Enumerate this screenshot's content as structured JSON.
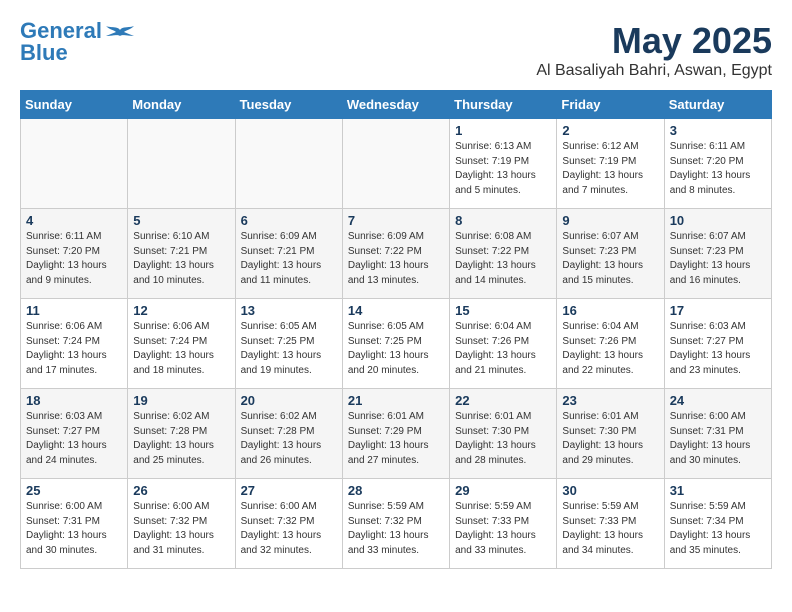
{
  "header": {
    "logo_line1": "General",
    "logo_line2": "Blue",
    "month_year": "May 2025",
    "location": "Al Basaliyah Bahri, Aswan, Egypt"
  },
  "weekdays": [
    "Sunday",
    "Monday",
    "Tuesday",
    "Wednesday",
    "Thursday",
    "Friday",
    "Saturday"
  ],
  "weeks": [
    [
      {
        "day": "",
        "info": ""
      },
      {
        "day": "",
        "info": ""
      },
      {
        "day": "",
        "info": ""
      },
      {
        "day": "",
        "info": ""
      },
      {
        "day": "1",
        "info": "Sunrise: 6:13 AM\nSunset: 7:19 PM\nDaylight: 13 hours\nand 5 minutes."
      },
      {
        "day": "2",
        "info": "Sunrise: 6:12 AM\nSunset: 7:19 PM\nDaylight: 13 hours\nand 7 minutes."
      },
      {
        "day": "3",
        "info": "Sunrise: 6:11 AM\nSunset: 7:20 PM\nDaylight: 13 hours\nand 8 minutes."
      }
    ],
    [
      {
        "day": "4",
        "info": "Sunrise: 6:11 AM\nSunset: 7:20 PM\nDaylight: 13 hours\nand 9 minutes."
      },
      {
        "day": "5",
        "info": "Sunrise: 6:10 AM\nSunset: 7:21 PM\nDaylight: 13 hours\nand 10 minutes."
      },
      {
        "day": "6",
        "info": "Sunrise: 6:09 AM\nSunset: 7:21 PM\nDaylight: 13 hours\nand 11 minutes."
      },
      {
        "day": "7",
        "info": "Sunrise: 6:09 AM\nSunset: 7:22 PM\nDaylight: 13 hours\nand 13 minutes."
      },
      {
        "day": "8",
        "info": "Sunrise: 6:08 AM\nSunset: 7:22 PM\nDaylight: 13 hours\nand 14 minutes."
      },
      {
        "day": "9",
        "info": "Sunrise: 6:07 AM\nSunset: 7:23 PM\nDaylight: 13 hours\nand 15 minutes."
      },
      {
        "day": "10",
        "info": "Sunrise: 6:07 AM\nSunset: 7:23 PM\nDaylight: 13 hours\nand 16 minutes."
      }
    ],
    [
      {
        "day": "11",
        "info": "Sunrise: 6:06 AM\nSunset: 7:24 PM\nDaylight: 13 hours\nand 17 minutes."
      },
      {
        "day": "12",
        "info": "Sunrise: 6:06 AM\nSunset: 7:24 PM\nDaylight: 13 hours\nand 18 minutes."
      },
      {
        "day": "13",
        "info": "Sunrise: 6:05 AM\nSunset: 7:25 PM\nDaylight: 13 hours\nand 19 minutes."
      },
      {
        "day": "14",
        "info": "Sunrise: 6:05 AM\nSunset: 7:25 PM\nDaylight: 13 hours\nand 20 minutes."
      },
      {
        "day": "15",
        "info": "Sunrise: 6:04 AM\nSunset: 7:26 PM\nDaylight: 13 hours\nand 21 minutes."
      },
      {
        "day": "16",
        "info": "Sunrise: 6:04 AM\nSunset: 7:26 PM\nDaylight: 13 hours\nand 22 minutes."
      },
      {
        "day": "17",
        "info": "Sunrise: 6:03 AM\nSunset: 7:27 PM\nDaylight: 13 hours\nand 23 minutes."
      }
    ],
    [
      {
        "day": "18",
        "info": "Sunrise: 6:03 AM\nSunset: 7:27 PM\nDaylight: 13 hours\nand 24 minutes."
      },
      {
        "day": "19",
        "info": "Sunrise: 6:02 AM\nSunset: 7:28 PM\nDaylight: 13 hours\nand 25 minutes."
      },
      {
        "day": "20",
        "info": "Sunrise: 6:02 AM\nSunset: 7:28 PM\nDaylight: 13 hours\nand 26 minutes."
      },
      {
        "day": "21",
        "info": "Sunrise: 6:01 AM\nSunset: 7:29 PM\nDaylight: 13 hours\nand 27 minutes."
      },
      {
        "day": "22",
        "info": "Sunrise: 6:01 AM\nSunset: 7:30 PM\nDaylight: 13 hours\nand 28 minutes."
      },
      {
        "day": "23",
        "info": "Sunrise: 6:01 AM\nSunset: 7:30 PM\nDaylight: 13 hours\nand 29 minutes."
      },
      {
        "day": "24",
        "info": "Sunrise: 6:00 AM\nSunset: 7:31 PM\nDaylight: 13 hours\nand 30 minutes."
      }
    ],
    [
      {
        "day": "25",
        "info": "Sunrise: 6:00 AM\nSunset: 7:31 PM\nDaylight: 13 hours\nand 30 minutes."
      },
      {
        "day": "26",
        "info": "Sunrise: 6:00 AM\nSunset: 7:32 PM\nDaylight: 13 hours\nand 31 minutes."
      },
      {
        "day": "27",
        "info": "Sunrise: 6:00 AM\nSunset: 7:32 PM\nDaylight: 13 hours\nand 32 minutes."
      },
      {
        "day": "28",
        "info": "Sunrise: 5:59 AM\nSunset: 7:32 PM\nDaylight: 13 hours\nand 33 minutes."
      },
      {
        "day": "29",
        "info": "Sunrise: 5:59 AM\nSunset: 7:33 PM\nDaylight: 13 hours\nand 33 minutes."
      },
      {
        "day": "30",
        "info": "Sunrise: 5:59 AM\nSunset: 7:33 PM\nDaylight: 13 hours\nand 34 minutes."
      },
      {
        "day": "31",
        "info": "Sunrise: 5:59 AM\nSunset: 7:34 PM\nDaylight: 13 hours\nand 35 minutes."
      }
    ]
  ]
}
